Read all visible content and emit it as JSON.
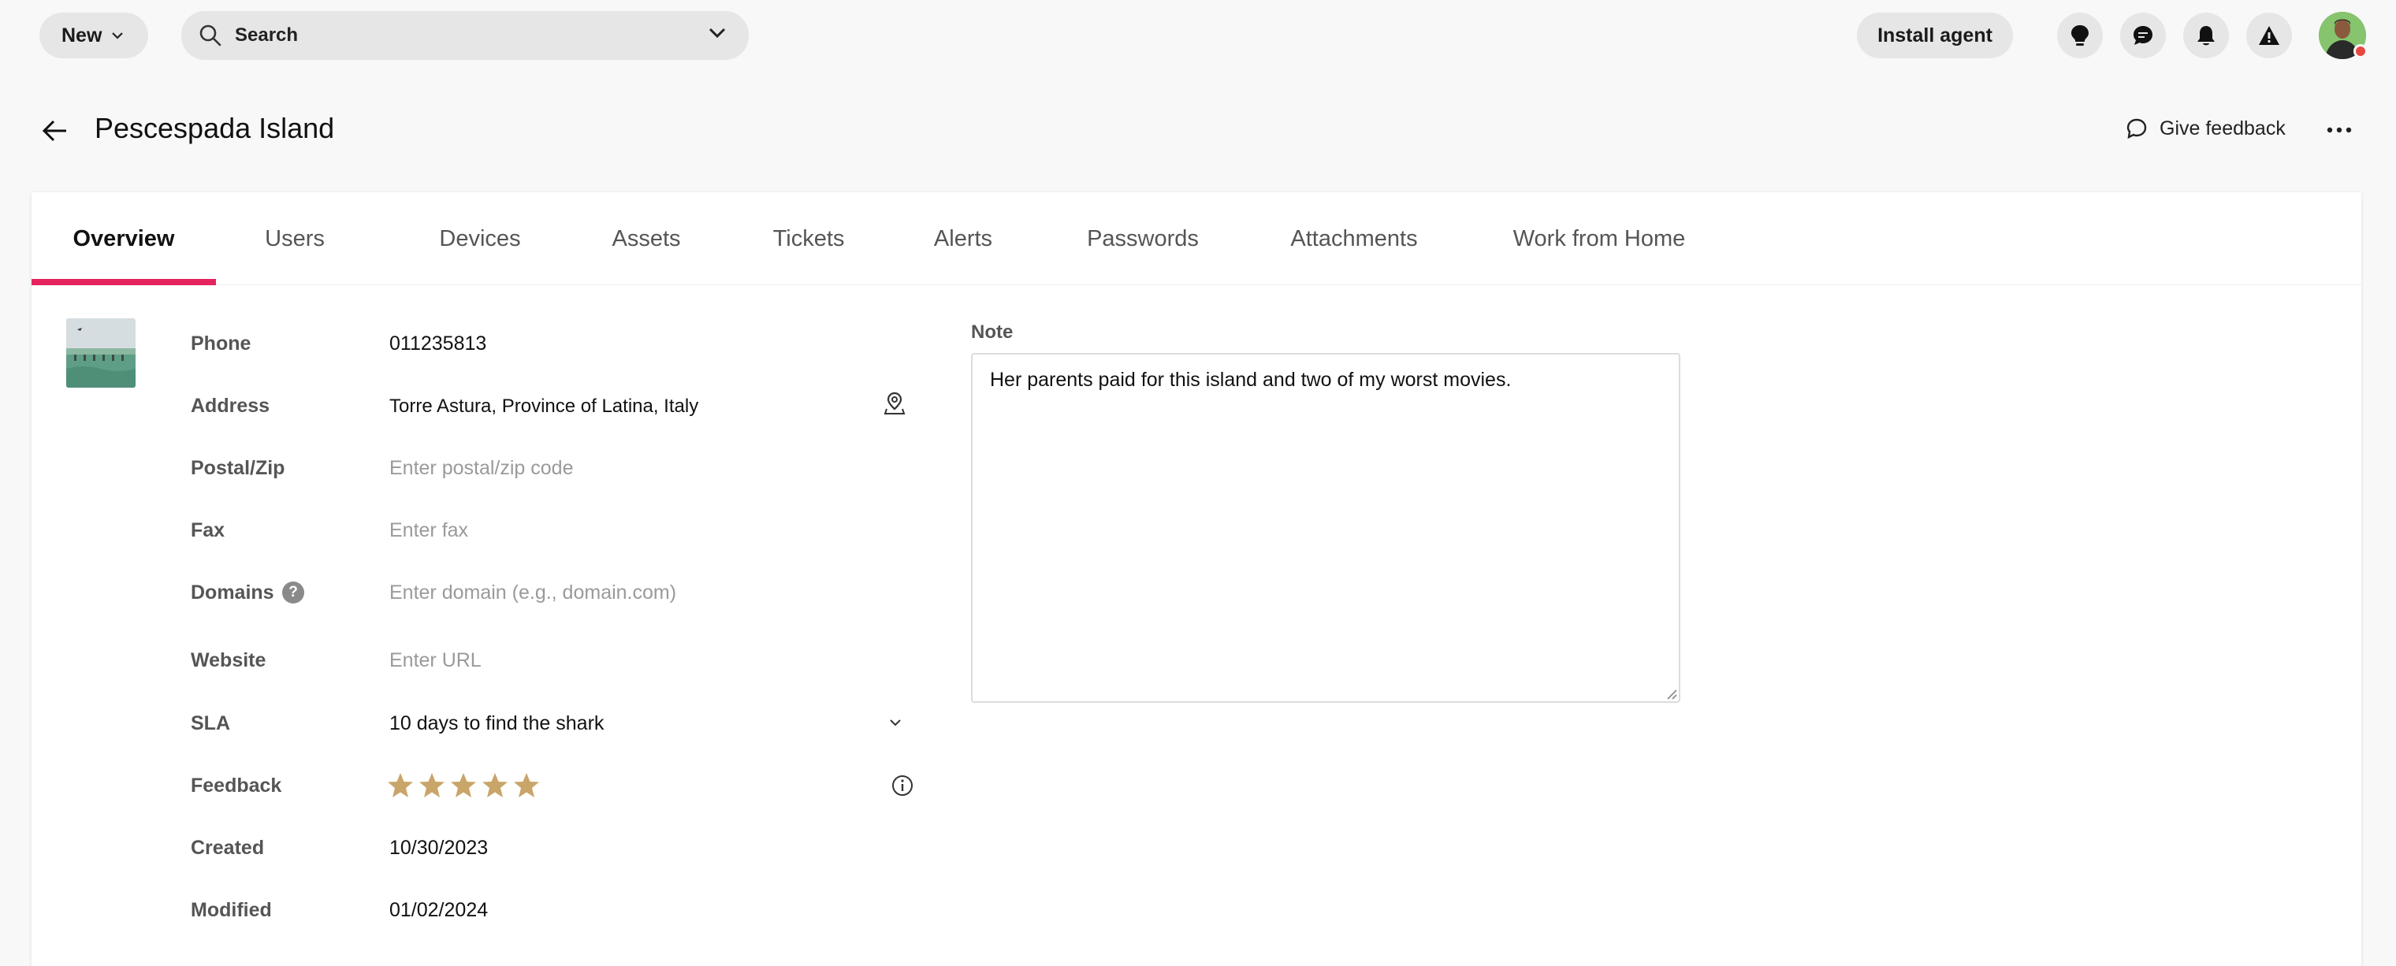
{
  "topbar": {
    "new_label": "New",
    "search_label": "Search",
    "install_label": "Install agent",
    "icons": [
      "lightbulb-icon",
      "chat-icon",
      "bell-icon",
      "warning-icon"
    ]
  },
  "header": {
    "title": "Pescespada Island",
    "feedback_label": "Give feedback"
  },
  "tabs": [
    {
      "label": "Overview",
      "active": true
    },
    {
      "label": "Users"
    },
    {
      "label": "Devices"
    },
    {
      "label": "Assets"
    },
    {
      "label": "Tickets"
    },
    {
      "label": "Alerts"
    },
    {
      "label": "Passwords"
    },
    {
      "label": "Attachments"
    },
    {
      "label": "Work from Home"
    }
  ],
  "fields": {
    "phone": {
      "label": "Phone",
      "value": "011235813"
    },
    "address": {
      "label": "Address",
      "value": "Torre Astura, Province of Latina, Italy"
    },
    "postal": {
      "label": "Postal/Zip",
      "placeholder": "Enter postal/zip code"
    },
    "fax": {
      "label": "Fax",
      "placeholder": "Enter fax"
    },
    "domains": {
      "label": "Domains",
      "placeholder": "Enter domain (e.g., domain.com)",
      "help": "?"
    },
    "website": {
      "label": "Website",
      "placeholder": "Enter URL"
    },
    "sla": {
      "label": "SLA",
      "value": "10 days to find the shark"
    },
    "feedback": {
      "label": "Feedback",
      "rating": 5,
      "max": 5
    },
    "created": {
      "label": "Created",
      "value": "10/30/2023"
    },
    "modified": {
      "label": "Modified",
      "value": "01/02/2024"
    }
  },
  "note": {
    "label": "Note",
    "value": "Her parents paid for this island and two of my worst movies."
  },
  "colors": {
    "accent": "#e5245f",
    "star": "#c9a56a",
    "avatar_status": "#e8473f"
  }
}
